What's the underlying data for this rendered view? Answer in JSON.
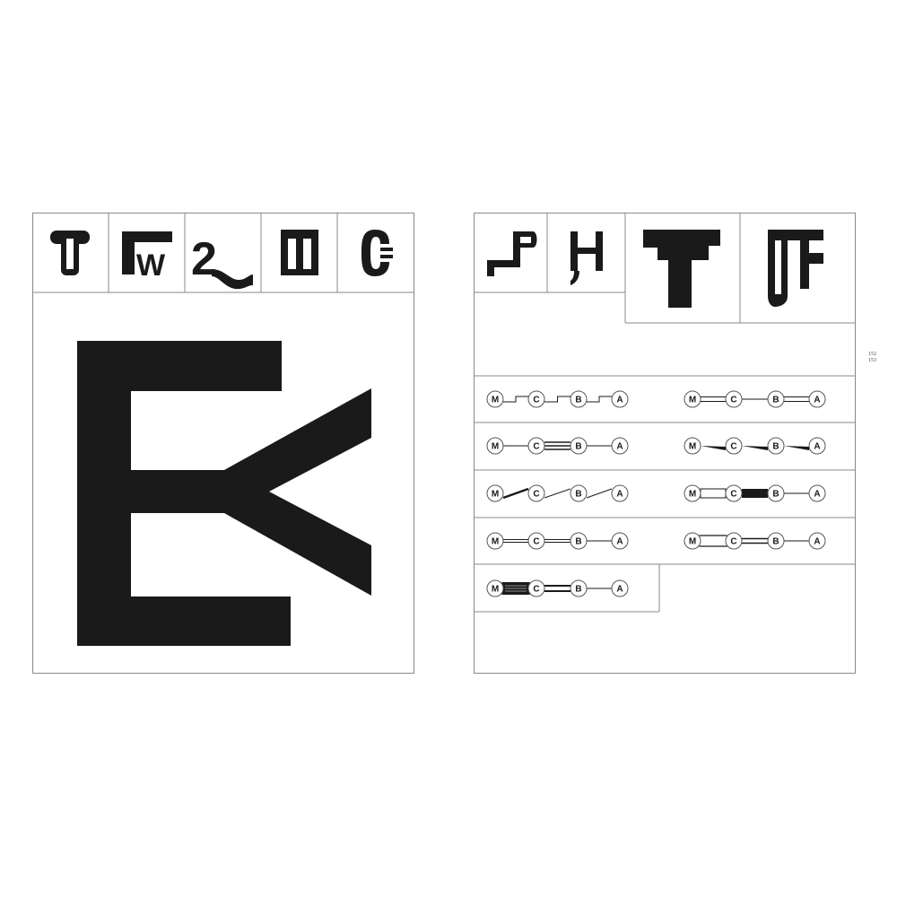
{
  "page_numbers": {
    "left": "152",
    "right": "153"
  },
  "left_page": {
    "glyph_row": [
      "T",
      "W",
      "2",
      "M",
      "C"
    ],
    "main_glyph": "EK"
  },
  "right_page": {
    "glyph_row": [
      "P",
      "H",
      "T",
      "JF"
    ],
    "line_diagrams": [
      {
        "nodes": [
          "M",
          "C",
          "B",
          "A"
        ],
        "style": "stepped"
      },
      {
        "nodes": [
          "M",
          "C",
          "B",
          "A"
        ],
        "style": "double-line"
      },
      {
        "nodes": [
          "M",
          "C",
          "B",
          "A"
        ],
        "style": "triple-line"
      },
      {
        "nodes": [
          "M",
          "C",
          "B",
          "A"
        ],
        "style": "wedge"
      },
      {
        "nodes": [
          "M",
          "C",
          "B",
          "A"
        ],
        "style": "diagonal"
      },
      {
        "nodes": [
          "M",
          "C",
          "B",
          "A"
        ],
        "style": "bold-bar"
      },
      {
        "nodes": [
          "M",
          "C",
          "B",
          "A"
        ],
        "style": "thin-double"
      },
      {
        "nodes": [
          "M",
          "C",
          "B",
          "A"
        ],
        "style": "cylinder"
      },
      {
        "nodes": [
          "M",
          "C",
          "B",
          "A"
        ],
        "style": "heavy-cylinder"
      }
    ]
  }
}
